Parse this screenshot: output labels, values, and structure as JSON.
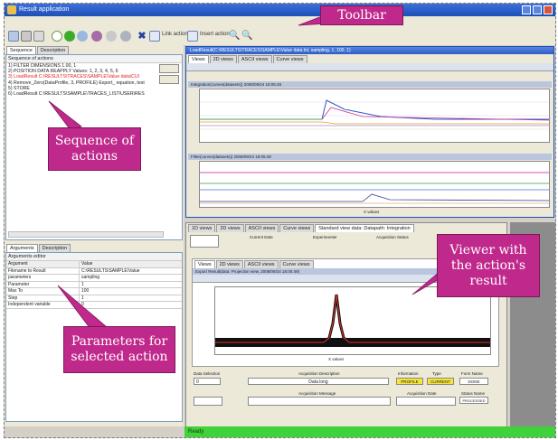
{
  "window": {
    "title": "Result application"
  },
  "toolbar": {
    "buttons": [
      "new-icon",
      "open-icon",
      "save-icon",
      "undo-icon",
      "run-icon",
      "refresh-icon",
      "settings-icon",
      "stop-icon",
      "delete-icon"
    ],
    "link_actions_label": "Link action",
    "insert_action_label": "Insert action"
  },
  "left_panel": {
    "sequence_tabs": [
      "Sequence",
      "Description"
    ],
    "sequence_header": "Sequence of actions",
    "sequence_items": [
      "1) FILTER DIMENSIONS 1.00, 1",
      "2) POSITION DATA REAPPLY Values: 1, 2, 3, 4, 5, 6",
      "3) LoadResult C:\\RESULTS\\TRACES\\SAMPLE\\Value data\\CUI",
      "4) Remove_Zero(DataProfile, 3, PROFILE) Export_ equation, test",
      "5) STORE",
      "6) LoadResult C:\\RESULTS\\SAMPLE\\TRACES_LIST\\USER\\RES"
    ],
    "param_tabs": [
      "Arguments",
      "Description"
    ],
    "param_header": "Arguments editor",
    "param_columns": [
      "Argument",
      "Value"
    ],
    "param_rows": [
      [
        "Filename to Result",
        "C:\\RESULTS\\SAMPLE\\Value"
      ],
      [
        "parameters",
        "sampling"
      ],
      [
        "Parameter",
        "1"
      ],
      [
        "Max To",
        "100"
      ],
      [
        "Step",
        "1"
      ],
      [
        "Independent variable",
        "0"
      ]
    ]
  },
  "viewer_top": {
    "title": "LoadResult(C:\\RESULTS\\TRACES\\SAMPLE\\Value data.txt, sampling, 1, 100, 1)",
    "tabs": [
      "Views",
      "2D views",
      "ASCII views",
      "Curve views"
    ],
    "plot1_caption": "Integration(curves(datasets))  2008/09/24 18:05:49",
    "plot2_caption": "Filter(curves(datasets))  2008/09/24 18:05:49",
    "xlabel": "X values",
    "ylabel": "Y values"
  },
  "viewer_bottom": {
    "tabs": [
      "1D views",
      "2D views",
      "ASCII views",
      "Curve views",
      "Standard view data: Datapath: Integration"
    ],
    "info_labels": [
      "Current Date",
      "Experimenter",
      "Acquisition Status"
    ],
    "plot_caption": "Export Result(data: Projection view, 2008/09/24 18:05:49)",
    "xlabel": "X values",
    "ylabel": "Y values",
    "data_selection_label": "Data Selection",
    "data_selection_value": "0",
    "acq_description_label": "Acquisition Description",
    "acq_description_value": "Data long",
    "info_title_label": "Information",
    "info_type_label": "Type",
    "info_value_label": "Form Name",
    "info_title_value": "PROFILE",
    "info_type_value": "CURRENT",
    "info_value_value": "DONE",
    "acq_message_label": "Acquisition Message",
    "acq_date_label": "Acquisition Date",
    "status_label": "Status Name",
    "status_value": "PROCESSED"
  },
  "status_bar": {
    "text": "Ready"
  },
  "callouts": {
    "toolbar": "Toolbar",
    "sequence": "Sequence of actions",
    "viewer": "Viewer with the action's result",
    "parameters": "Parameters for selected action"
  },
  "colors": {
    "callout": "#c0298c",
    "titlebar": "#1d4fb5",
    "statusbar": "#3fd23a",
    "plot_peak": "#e0322a"
  }
}
